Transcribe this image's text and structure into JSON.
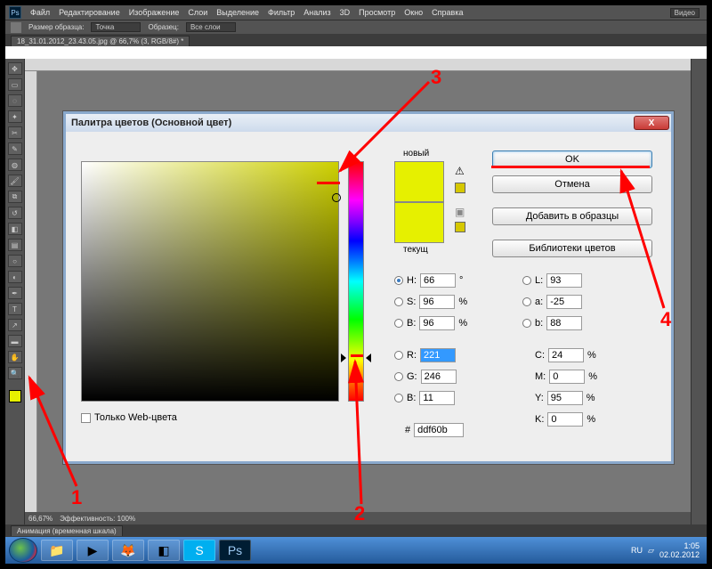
{
  "menu": {
    "items": [
      "Файл",
      "Редактирование",
      "Изображение",
      "Слои",
      "Выделение",
      "Фильтр",
      "Анализ",
      "3D",
      "Просмотр",
      "Окно",
      "Справка"
    ],
    "video_label": "Видео"
  },
  "toolbar2": {
    "size_label": "Размер образца:",
    "size_value": "Точка",
    "sample_label": "Образец:",
    "sample_value": "Все слои"
  },
  "doc": {
    "tab": "18_31.01.2012_23.43.05.jpg @ 66,7% (3, RGB/8#) *"
  },
  "status": {
    "zoom": "66,67%",
    "eff": "Эффективность: 100%",
    "panel": "Анимация (временная шкала)"
  },
  "dialog": {
    "title": "Палитра цветов (Основной цвет)",
    "close": "X",
    "new": "новый",
    "current": "текущ",
    "ok": "OK",
    "cancel": "Отмена",
    "add_swatch": "Добавить в образцы",
    "libraries": "Библиотеки цветов",
    "webonly": "Только Web-цвета",
    "labels": {
      "H": "H:",
      "S": "S:",
      "B": "B:",
      "R": "R:",
      "G": "G:",
      "Bb": "B:",
      "L": "L:",
      "a": "a:",
      "b": "b:",
      "C": "C:",
      "M": "M:",
      "Y": "Y:",
      "K": "K:",
      "hex": "#",
      "deg": "°",
      "pct": "%"
    },
    "values": {
      "H": "66",
      "S": "96",
      "B": "96",
      "R": "221",
      "G": "246",
      "Bb": "11",
      "L": "93",
      "a": "-25",
      "b": "88",
      "C": "24",
      "M": "0",
      "Y": "95",
      "K": "0",
      "hex": "ddf60b"
    }
  },
  "anno": {
    "n1": "1",
    "n2": "2",
    "n3": "3",
    "n4": "4"
  },
  "taskbar": {
    "lang": "RU",
    "time": "1:05",
    "date": "02.02.2012"
  }
}
